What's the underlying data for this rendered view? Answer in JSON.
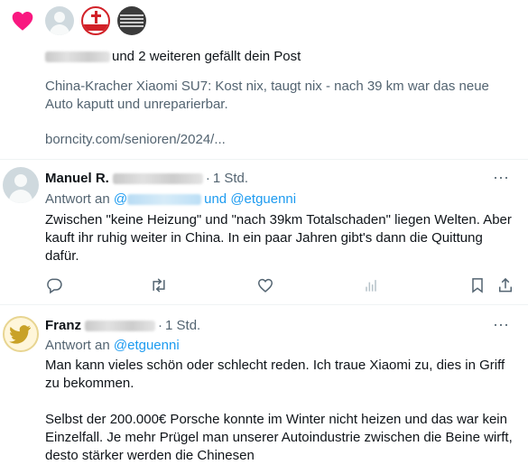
{
  "notification": {
    "liked_by_suffix": "und 2 weiteren gefällt dein Post",
    "quoted_text": "China-Kracher Xiaomi SU7: Kost nix, taugt nix - nach 39 km war das neue Auto kaputt und unreparierbar.",
    "link": "borncity.com/senioren/2024/..."
  },
  "replies": [
    {
      "name": "Manuel R.",
      "time": "1 Std.",
      "reply_to_prefix": "Antwort an",
      "reply_to_and": "und",
      "reply_to_handle": "@etguenni",
      "body": "Zwischen \"keine Heizung\" und \"nach 39km Totalschaden\" liegen Welten. Aber kauft ihr ruhig weiter in China. In ein paar Jahren gibt's dann die Quittung dafür.",
      "more": "···"
    },
    {
      "name": "Franz",
      "time": "1 Std.",
      "reply_to_prefix": "Antwort an",
      "reply_to_handle": "@etguenni",
      "body": "Man kann vieles schön oder schlecht reden. Ich traue Xiaomi zu, dies in Griff zu bekommen.\n\nSelbst der 200.000€ Porsche konnte im Winter nicht heizen und das war kein Einzelfall. Je mehr Prügel man unserer Autoindustrie zwischen die Beine wirft, desto stärker werden die Chinesen",
      "more": "···"
    }
  ],
  "colors": {
    "like": "#f91880",
    "link": "#1d9bf0",
    "secondary_text": "#536471",
    "primary_text": "#0f1419"
  },
  "icons": [
    "heart-icon",
    "reply-icon",
    "retweet-icon",
    "like-icon",
    "views-icon",
    "bookmark-icon",
    "share-icon",
    "more-icon"
  ]
}
